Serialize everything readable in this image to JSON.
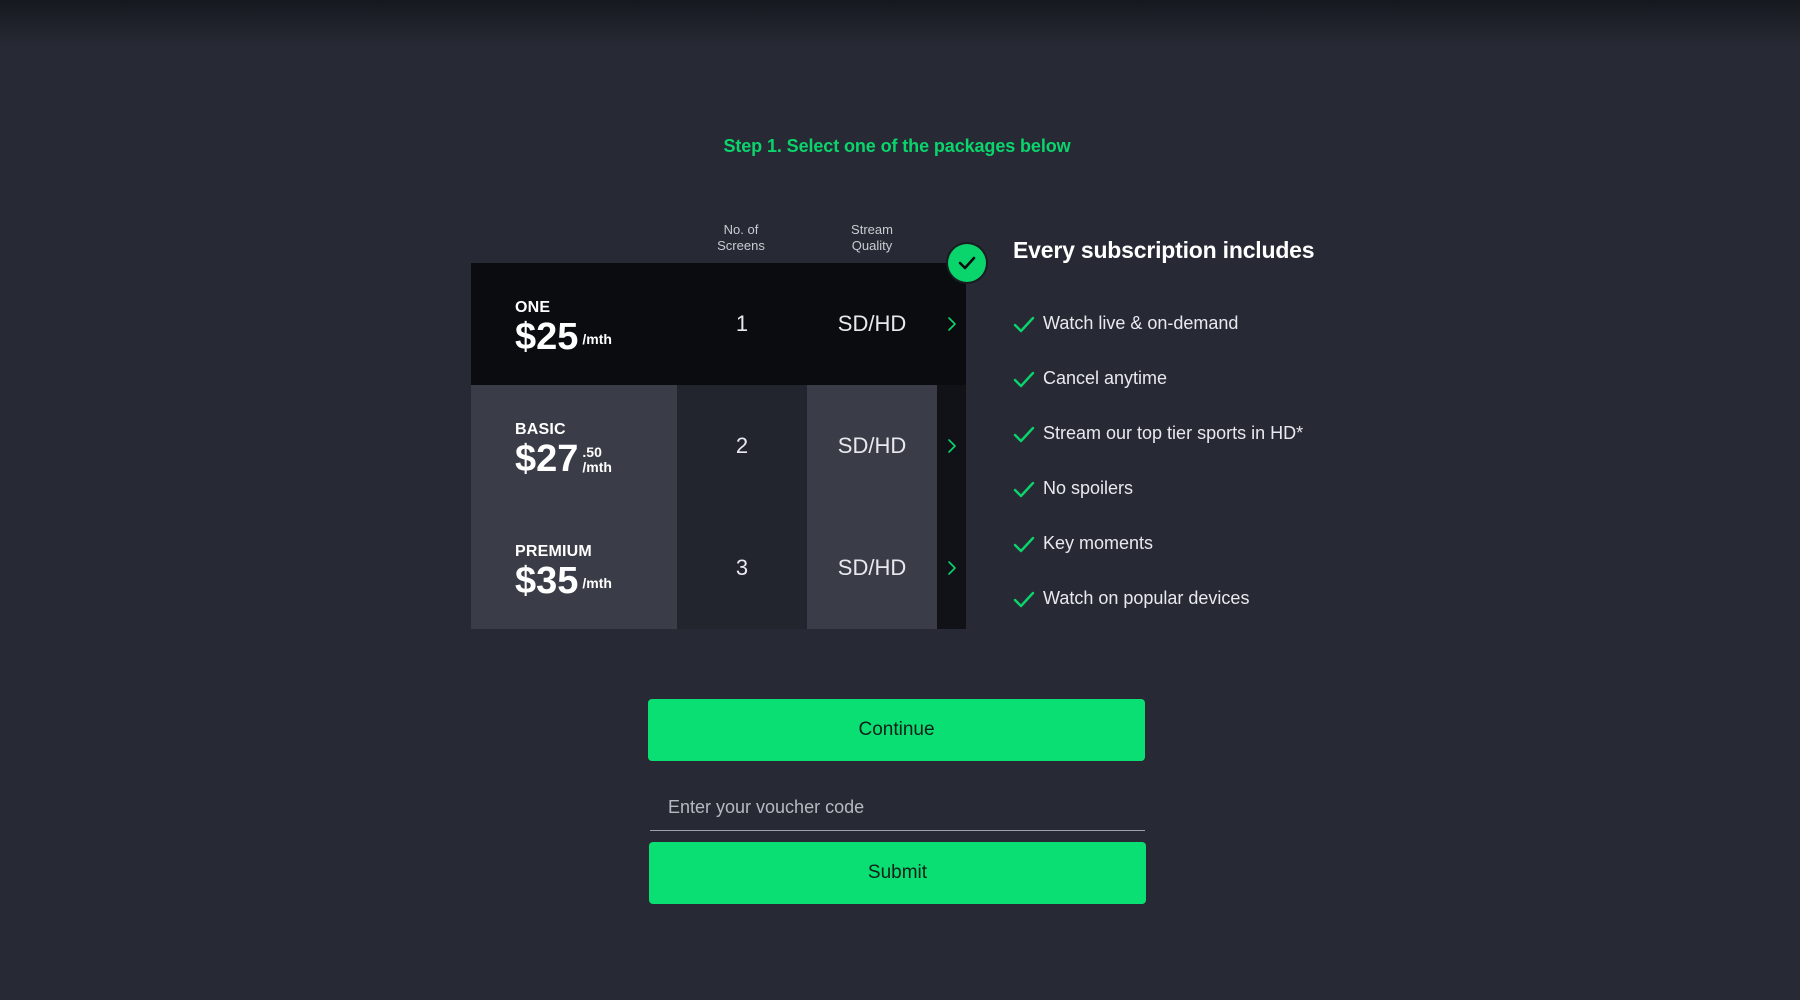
{
  "step_title": "Step 1. Select one of the packages below",
  "table": {
    "columns": {
      "screens": [
        "No. of",
        "Screens"
      ],
      "quality": [
        "Stream",
        "Quality"
      ]
    },
    "packages": [
      {
        "name": "ONE",
        "price": "$25",
        "cents": "",
        "per": "/mth",
        "screens": "1",
        "quality": "SD/HD",
        "selected": true
      },
      {
        "name": "BASIC",
        "price": "$27",
        "cents": ".50",
        "per": "/mth",
        "screens": "2",
        "quality": "SD/HD",
        "selected": false
      },
      {
        "name": "PREMIUM",
        "price": "$35",
        "cents": "",
        "per": "/mth",
        "screens": "3",
        "quality": "SD/HD",
        "selected": false
      }
    ],
    "selected_icon": "check-circle-icon",
    "row_icon": "chevron-right-icon"
  },
  "includes": {
    "title": "Every subscription includes",
    "icon": "check-icon",
    "items": [
      "Watch live & on-demand",
      "Cancel anytime",
      "Stream our top tier sports in HD*",
      "No spoilers",
      "Key moments",
      "Watch on popular devices"
    ]
  },
  "continue_label": "Continue",
  "voucher": {
    "placeholder": "Enter your voucher code",
    "value": ""
  },
  "submit_label": "Submit",
  "colors": {
    "accent": "#0adf74",
    "step_title": "#0ad46c",
    "background": "#272a34",
    "selected_row": "#0b0c10"
  }
}
